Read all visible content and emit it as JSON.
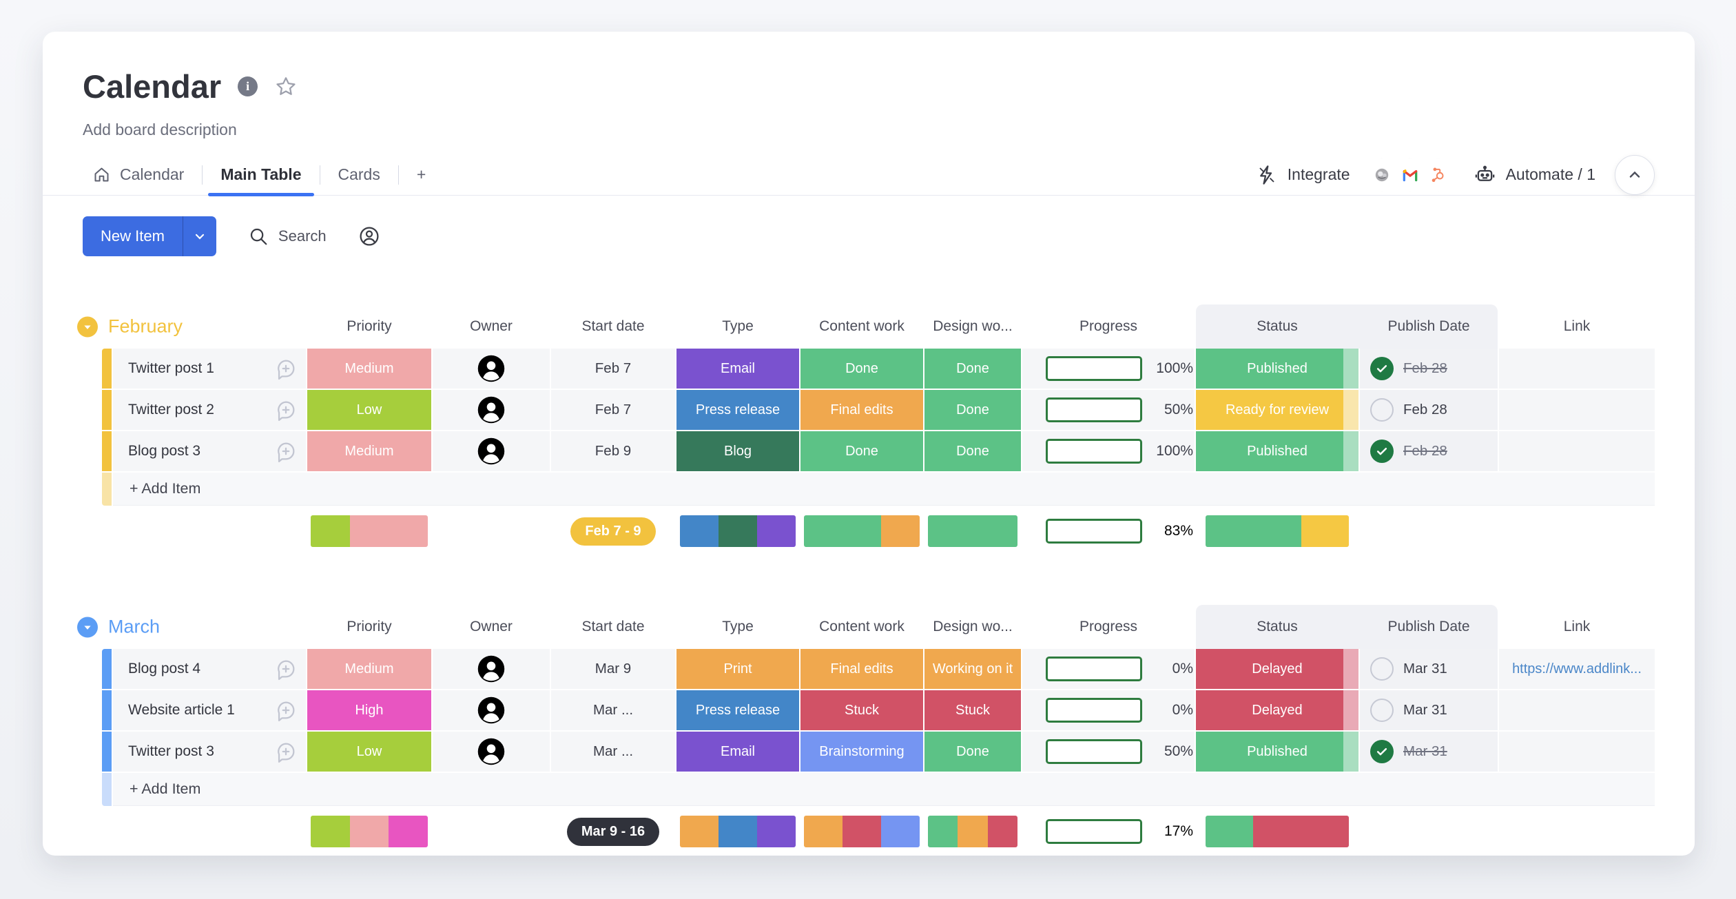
{
  "board": {
    "title": "Calendar",
    "description": "Add board description"
  },
  "tabs": {
    "calendar": "Calendar",
    "main_table": "Main Table",
    "cards": "Cards",
    "add_tab": "+",
    "integrate": "Integrate",
    "automate": "Automate / 1",
    "badges": [
      "mailchimp",
      "gmail",
      "hubspot"
    ]
  },
  "toolbar": {
    "new_item": "New Item",
    "search": "Search"
  },
  "columns": {
    "priority": "Priority",
    "owner": "Owner",
    "start": "Start date",
    "type": "Type",
    "content": "Content work",
    "design": "Design wo...",
    "progress": "Progress",
    "status": "Status",
    "publish": "Publish Date",
    "link": "Link"
  },
  "palette": {
    "green": "#5cc286",
    "green_light": "#a9dec0",
    "dark_green": "#36795b",
    "progress_green": "#3b7d46",
    "pink": "#f0a8a9",
    "lime": "#a6ce3c",
    "magenta": "#e855c1",
    "purple": "#7a52cf",
    "blue": "#4386c8",
    "periwinkle": "#7595f2",
    "orange": "#f0a84e",
    "red": "#d15266",
    "red_light": "#e9aab6",
    "yellow": "#f5c843",
    "yellow_light": "#f9e6ad",
    "link_blue": "#4a86c8"
  },
  "groups": [
    {
      "name": "February",
      "color": "#f2c23e",
      "color_light": "#f8e3a6",
      "add_item": "+ Add Item",
      "items": [
        {
          "name": "Twitter post 1",
          "priority": "Medium",
          "start": "Feb 7",
          "type": "Email",
          "content": "Done",
          "design": "Done",
          "progress_fill": "100%",
          "progress": "100%",
          "status": "Published",
          "publish": "Feb 28",
          "published": true,
          "link": ""
        },
        {
          "name": "Twitter post 2",
          "priority": "Low",
          "start": "Feb 7",
          "type": "Press release",
          "content": "Final edits",
          "design": "Done",
          "progress_fill": "50%",
          "progress": "50%",
          "status": "Ready for review",
          "publish": "Feb 28",
          "published": false,
          "link": ""
        },
        {
          "name": "Blog post 3",
          "priority": "Medium",
          "start": "Feb 9",
          "type": "Blog",
          "content": "Done",
          "design": "Done",
          "progress_fill": "100%",
          "progress": "100%",
          "status": "Published",
          "publish": "Feb 28",
          "published": true,
          "link": ""
        }
      ],
      "summary": {
        "date_range": "Feb 7 - 9",
        "pill_bg": "#f2c23e",
        "priority": [
          {
            "c": "#a6ce3c",
            "f": 1
          },
          {
            "c": "#f0a8a9",
            "f": 2
          }
        ],
        "type": [
          {
            "c": "#4386c8",
            "f": 1
          },
          {
            "c": "#36795b",
            "f": 1
          },
          {
            "c": "#7a52cf",
            "f": 1
          }
        ],
        "content": [
          {
            "c": "#5cc286",
            "f": 2
          },
          {
            "c": "#f0a84e",
            "f": 1
          }
        ],
        "design": [
          {
            "c": "#5cc286",
            "f": 3
          }
        ],
        "progress_fill": "83%",
        "progress": "83%",
        "status": [
          {
            "c": "#5cc286",
            "f": 2
          },
          {
            "c": "#f5c843",
            "f": 1
          }
        ]
      }
    },
    {
      "name": "March",
      "color": "#5b9df5",
      "color_light": "#c9dcfb",
      "add_item": "+ Add Item",
      "items": [
        {
          "name": "Blog post 4",
          "priority": "Medium",
          "start": "Mar 9",
          "type": "Print",
          "content": "Final edits",
          "design": "Working on it",
          "progress_fill": "0%",
          "progress": "0%",
          "status": "Delayed",
          "publish": "Mar 31",
          "published": false,
          "link": "https://www.addlink..."
        },
        {
          "name": "Website article 1",
          "priority": "High",
          "start": "Mar ...",
          "type": "Press release",
          "content": "Stuck",
          "design": "Stuck",
          "progress_fill": "0%",
          "progress": "0%",
          "status": "Delayed",
          "publish": "Mar 31",
          "published": false,
          "link": ""
        },
        {
          "name": "Twitter post 3",
          "priority": "Low",
          "start": "Mar ...",
          "type": "Email",
          "content": "Brainstorming",
          "design": "Done",
          "progress_fill": "50%",
          "progress": "50%",
          "status": "Published",
          "publish": "Mar 31",
          "published": true,
          "link": ""
        }
      ],
      "summary": {
        "date_range": "Mar 9 - 16",
        "pill_bg": "#30323b",
        "priority": [
          {
            "c": "#a6ce3c",
            "f": 1
          },
          {
            "c": "#f0a8a9",
            "f": 1
          },
          {
            "c": "#e855c1",
            "f": 1
          }
        ],
        "type": [
          {
            "c": "#f0a84e",
            "f": 1
          },
          {
            "c": "#4386c8",
            "f": 1
          },
          {
            "c": "#7a52cf",
            "f": 1
          }
        ],
        "content": [
          {
            "c": "#f0a84e",
            "f": 1
          },
          {
            "c": "#d15266",
            "f": 1
          },
          {
            "c": "#7595f2",
            "f": 1
          }
        ],
        "design": [
          {
            "c": "#5cc286",
            "f": 1
          },
          {
            "c": "#f0a84e",
            "f": 1
          },
          {
            "c": "#d15266",
            "f": 1
          }
        ],
        "progress_fill": "17%",
        "progress": "17%",
        "status": [
          {
            "c": "#5cc286",
            "f": 1
          },
          {
            "c": "#d15266",
            "f": 2
          }
        ]
      }
    }
  ]
}
